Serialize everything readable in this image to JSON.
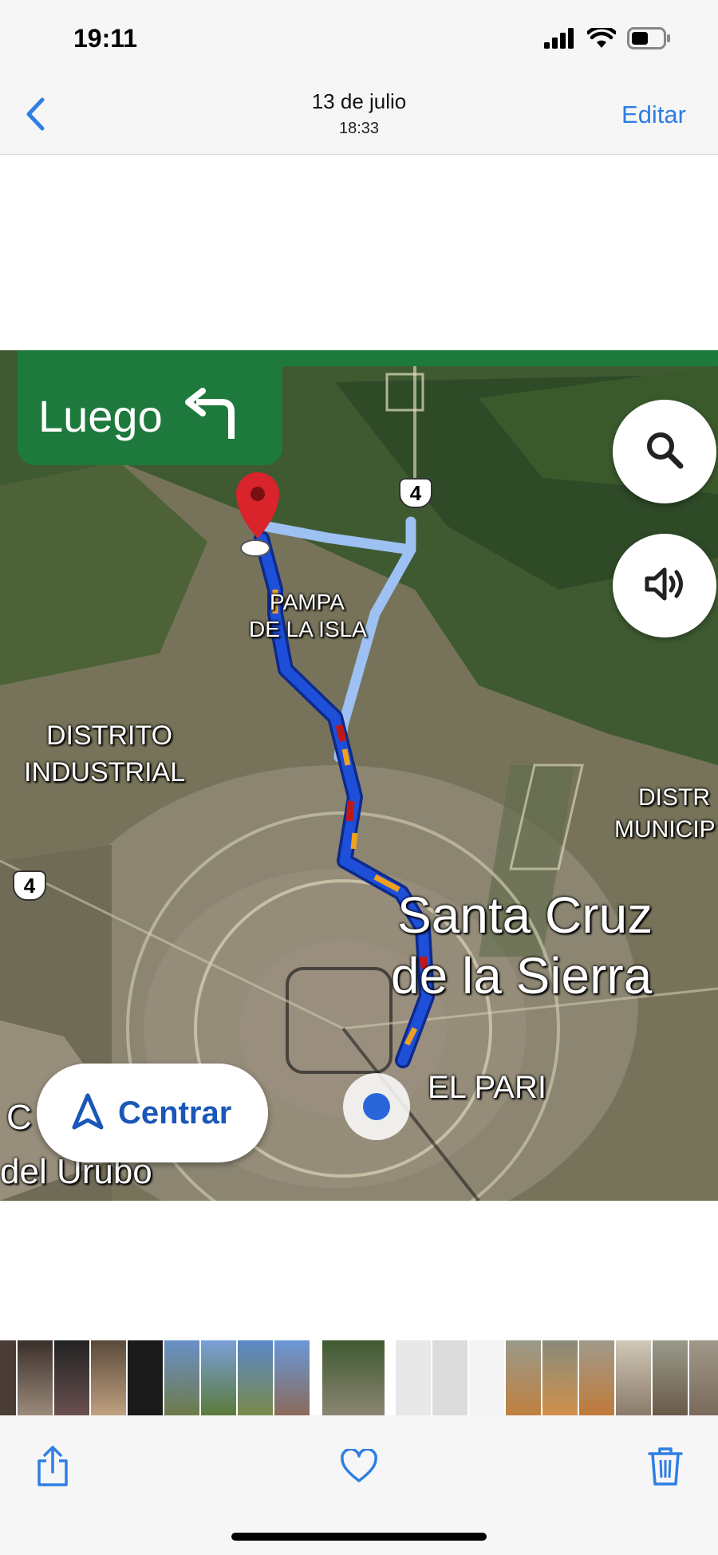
{
  "status_bar": {
    "time": "19:11",
    "icons": [
      "signal-icon",
      "wifi-icon",
      "battery-icon"
    ]
  },
  "header": {
    "back_icon": "chevron-left-icon",
    "title": "13 de julio",
    "subtitle": "18:33",
    "edit_label": "Editar"
  },
  "photo": {
    "maneuver_text": "Luego",
    "maneuver_icon": "turn-left-arrow-icon",
    "recenter_label": "Centrar",
    "map_labels": {
      "pampa_line1": "PAMPA",
      "pampa_line2": "DE LA ISLA",
      "distrito_line1": "DISTRITO",
      "distrito_line2": "INDUSTRIAL",
      "distr_line1": "DISTR",
      "distr_line2": "MUNICIP",
      "city_line1": "Santa Cruz",
      "city_line2": "de la Sierra",
      "el_pari": "EL PARI",
      "c_label": "C",
      "urubo_label": "del Urubo"
    },
    "route_shields": [
      "4",
      "4"
    ]
  },
  "toolbar": {
    "share_icon": "share-icon",
    "favorite_icon": "heart-icon",
    "delete_icon": "trash-icon"
  },
  "colors": {
    "accent": "#2f7ee4",
    "banner_green": "#1e7a3c",
    "route_blue": "#1e4fd8",
    "route_light": "#9cc1f2"
  }
}
